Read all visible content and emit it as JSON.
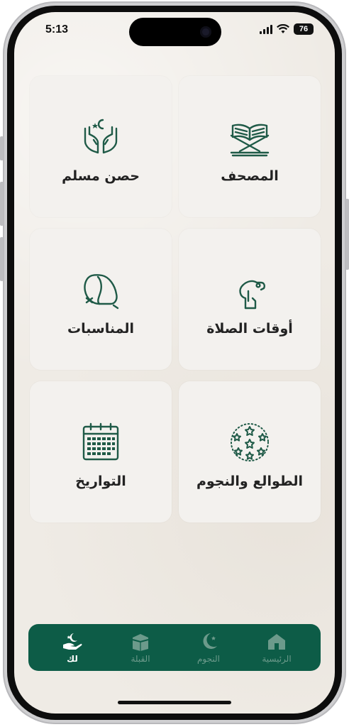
{
  "status_bar": {
    "time": "5:13",
    "battery": "76"
  },
  "cards": [
    {
      "label": "المصحف",
      "icon": "quran-stand-icon"
    },
    {
      "label": "حصن مسلم",
      "icon": "praying-hands-icon"
    },
    {
      "label": "أوقات الصلاة",
      "icon": "prayer-times-icon"
    },
    {
      "label": "المناسبات",
      "icon": "occasions-icon"
    },
    {
      "label": "الطوالع والنجوم",
      "icon": "stars-icon"
    },
    {
      "label": "التواريخ",
      "icon": "calendar-icon"
    }
  ],
  "tabbar": {
    "items": [
      {
        "label": "الرئيسية",
        "icon": "home-icon",
        "active": false
      },
      {
        "label": "النجوم",
        "icon": "moon-star-icon",
        "active": false
      },
      {
        "label": "القبلة",
        "icon": "kaaba-icon",
        "active": false
      },
      {
        "label": "لك",
        "icon": "hand-moon-icon",
        "active": true
      }
    ]
  },
  "colors": {
    "accent": "#0d5c47",
    "background": "#efebe5",
    "card": "#f3f1ee",
    "icon": "#1f5a47"
  }
}
